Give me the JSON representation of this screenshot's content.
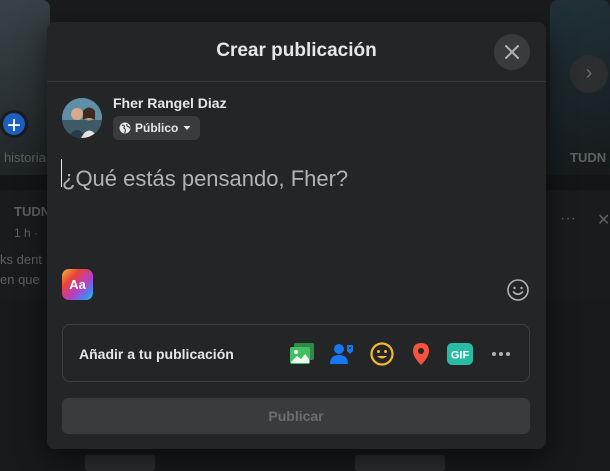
{
  "background": {
    "story_label": "r historia",
    "post_author": "TUDN",
    "post_meta": "1 h ·",
    "post_snippet_1": "ks dent",
    "post_snippet_2": "en que",
    "story_right_label": "TUDN",
    "more_glyph": "···",
    "close_glyph": "✕",
    "plus_glyph": "+",
    "next_glyph": "›"
  },
  "modal": {
    "title": "Crear publicación",
    "close_icon": "close-icon"
  },
  "user": {
    "name": "Fher Rangel Diaz",
    "privacy_label": "Público"
  },
  "composer": {
    "placeholder": "¿Qué estás pensando, Fher?",
    "aa_label": "Aa"
  },
  "add_to_post": {
    "label": "Añadir a tu publicación",
    "icons": [
      {
        "name": "photo-video-icon",
        "color": "#45bd62"
      },
      {
        "name": "tag-people-icon",
        "color": "#1877f2"
      },
      {
        "name": "feeling-icon",
        "color": "#f7b928"
      },
      {
        "name": "check-in-icon",
        "color": "#f5533d"
      },
      {
        "name": "gif-icon",
        "color": "#2abba7"
      },
      {
        "name": "more-options-icon",
        "color": "#b0b3b8"
      }
    ],
    "gif_label": "GIF"
  },
  "publish": {
    "label": "Publicar"
  },
  "colors": {
    "modal_bg": "#242526",
    "text_primary": "#e4e6eb",
    "text_secondary": "#b0b3b8",
    "accent": "#1877f2"
  }
}
